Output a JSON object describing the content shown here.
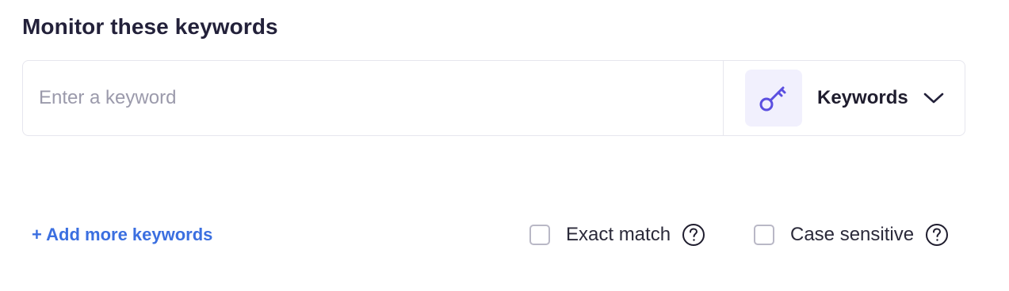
{
  "section": {
    "title": "Monitor these keywords"
  },
  "keyword_input": {
    "value": "",
    "placeholder": "Enter a keyword"
  },
  "type_selector": {
    "icon": "key-icon",
    "selected": "Keywords",
    "accent_color": "#5b4fe0"
  },
  "actions": {
    "add_more_label": "+ Add more keywords"
  },
  "options": {
    "exact_match": {
      "label": "Exact match",
      "checked": false,
      "help_icon": "question-circle-icon"
    },
    "case_sensitive": {
      "label": "Case sensitive",
      "checked": false,
      "help_icon": "question-circle-icon"
    }
  },
  "colors": {
    "link": "#3b6fe0",
    "icon_bg": "#f1f0fd",
    "border": "#e6e6ee"
  }
}
